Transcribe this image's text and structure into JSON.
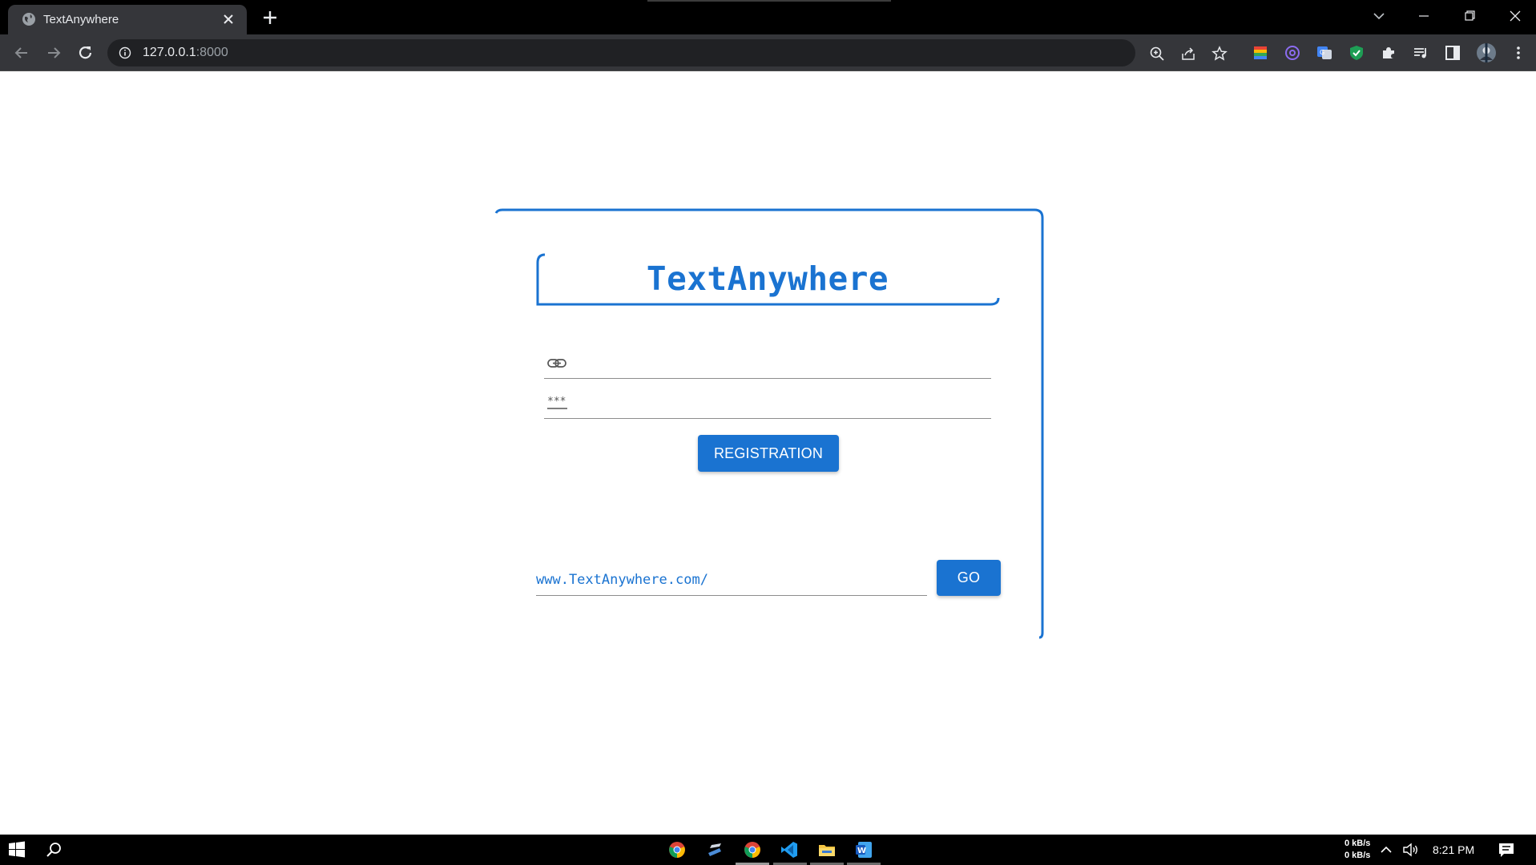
{
  "browser": {
    "tab_title": "TextAnywhere",
    "url_host": "127.0.0.1",
    "url_port": ":8000"
  },
  "app": {
    "brand": "TextAnywhere",
    "link_field_value": "",
    "password_field_value": "",
    "registration_label": "REGISTRATION",
    "url_prefix": "www.TextAnywhere.com/",
    "url_suffix_value": "",
    "go_label": "GO",
    "accent_color": "#1a73d1"
  },
  "taskbar": {
    "net_up": "0 kB/s",
    "net_down": "0 kB/s",
    "time": "8:21 PM",
    "apps": [
      "chrome-alt-icon",
      "python-icon",
      "chrome-icon",
      "vscode-icon",
      "file-explorer-icon",
      "word-icon"
    ]
  }
}
